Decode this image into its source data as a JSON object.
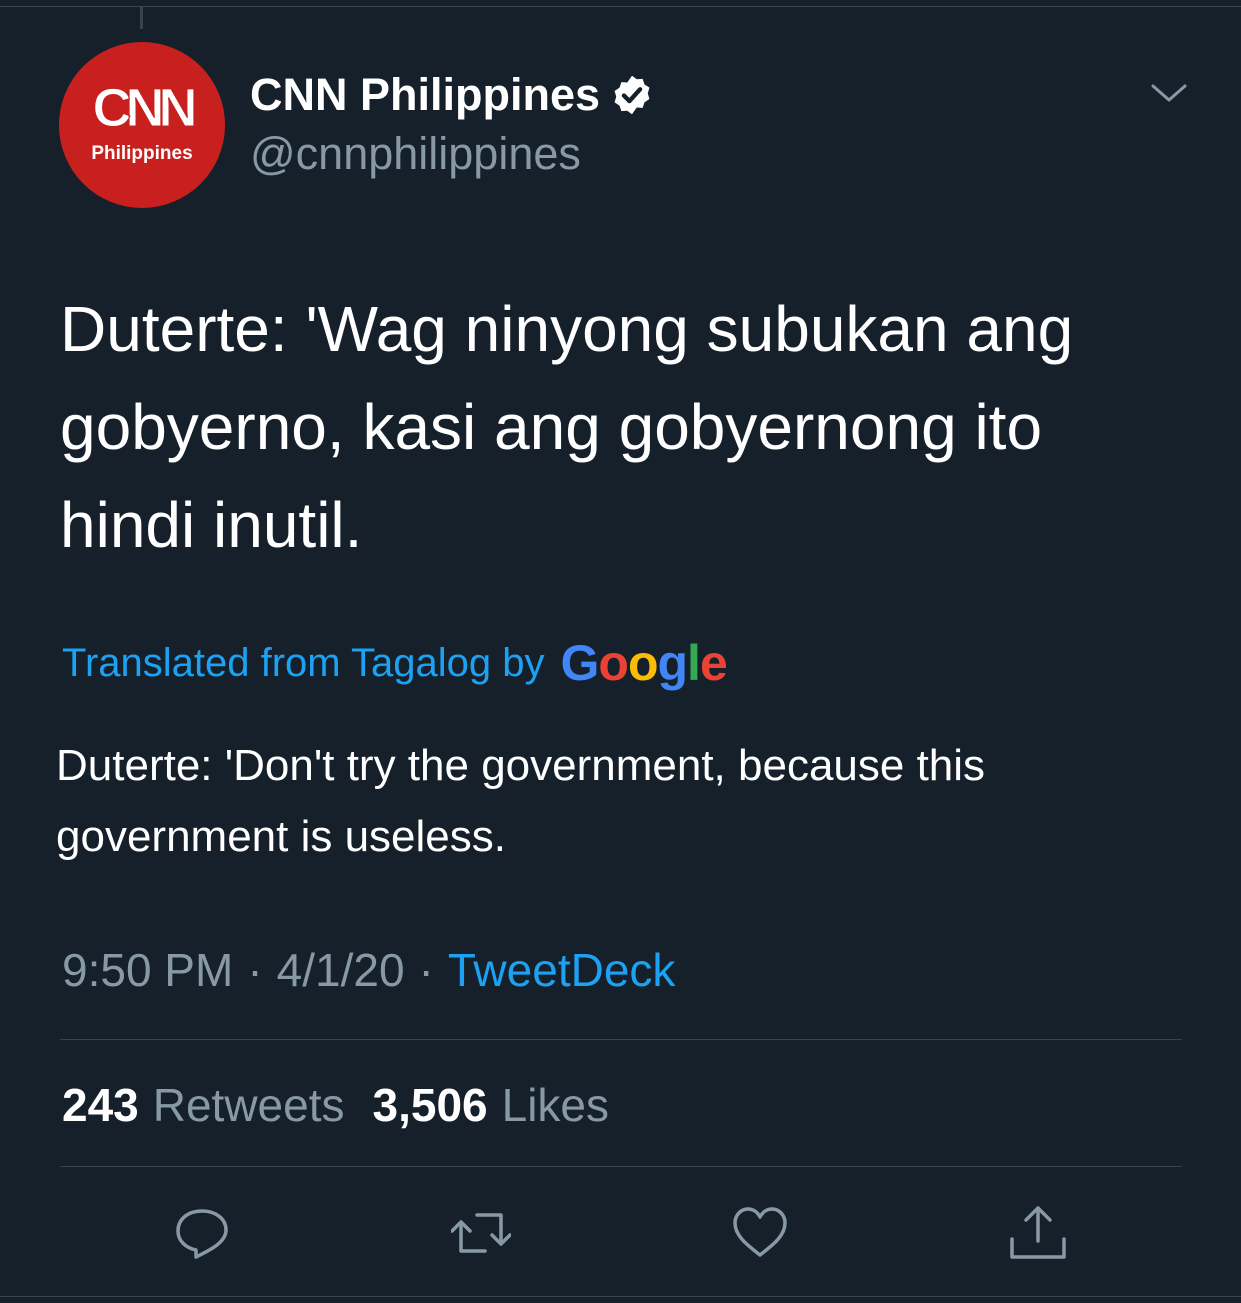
{
  "author": {
    "display_name": "CNN Philippines",
    "handle": "@cnnphilippines",
    "verified": true,
    "avatar": {
      "logo_text": "CNN",
      "logo_sub": "Philippines",
      "color": "#c8201e"
    }
  },
  "tweet": {
    "text": "Duterte: 'Wag ninyong subukan ang gobyerno, kasi ang gobyernong ito hindi inutil.",
    "translation_label": "Translated from Tagalog by",
    "translation_provider": "Google",
    "translation": "Duterte: 'Don't try the government, because this government is useless."
  },
  "meta": {
    "time": "9:50 PM",
    "separator": "·",
    "date": "4/1/20",
    "source": "TweetDeck"
  },
  "stats": {
    "retweets_count": "243",
    "retweets_label": "Retweets",
    "likes_count": "3,506",
    "likes_label": "Likes"
  },
  "actions": [
    "reply-icon",
    "retweet-icon",
    "like-icon",
    "share-icon"
  ],
  "colors": {
    "background": "#15202b",
    "accent": "#1da1f2",
    "muted": "#8899a6",
    "divider": "#38444d",
    "google_blue": "#4285f4",
    "google_red": "#ea4335",
    "google_yellow": "#fbbc05",
    "google_green": "#34a853"
  }
}
